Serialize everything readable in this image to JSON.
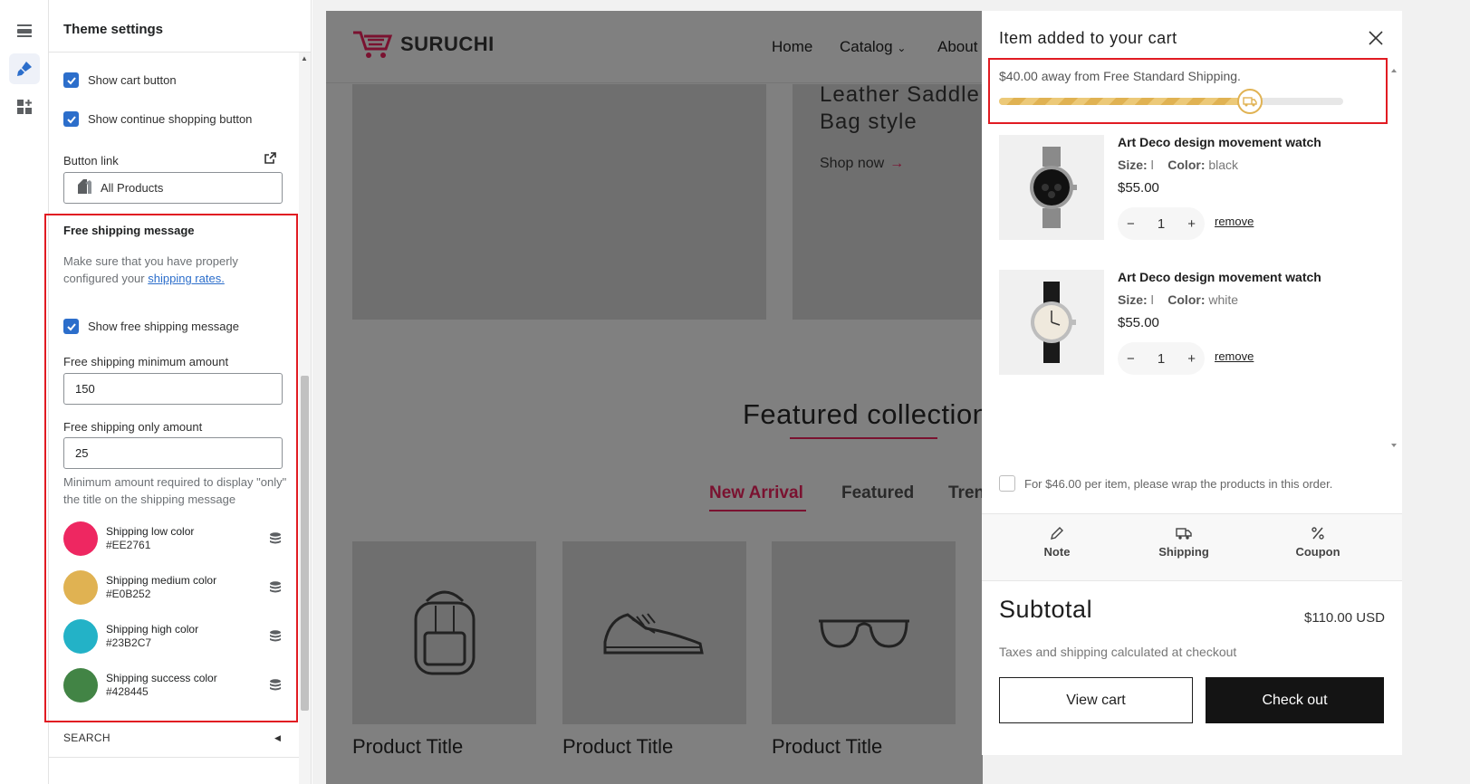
{
  "sidebar": {
    "title": "Theme settings",
    "show_cart_button": "Show cart button",
    "show_continue_button": "Show continue shopping button",
    "button_link_label": "Button link",
    "button_link_value": "All Products",
    "free_shipping": {
      "heading": "Free shipping message",
      "help_prefix": "Make sure that you have properly configured your",
      "help_link": "shipping rates.",
      "show_message_label": "Show free shipping message",
      "min_amount_label": "Free shipping minimum amount",
      "min_amount_value": "150",
      "only_amount_label": "Free shipping only amount",
      "only_amount_value": "25",
      "only_amount_help": "Minimum amount required to display \"only\" the title on the shipping message",
      "colors": [
        {
          "label": "Shipping low color",
          "hex": "#EE2761"
        },
        {
          "label": "Shipping medium color",
          "hex": "#E0B252"
        },
        {
          "label": "Shipping high color",
          "hex": "#23B2C7"
        },
        {
          "label": "Shipping success color",
          "hex": "#428445"
        }
      ]
    },
    "search_section": "SEARCH"
  },
  "store": {
    "logo": "SURUCHI",
    "nav": [
      "Home",
      "Catalog",
      "About"
    ],
    "hero_text_line1": "Leather Saddle",
    "hero_text_line2": "Bag style",
    "shop_now": "Shop now",
    "featured_title": "Featured collection",
    "tabs": [
      "New Arrival",
      "Featured",
      "Tren"
    ],
    "product_titles": [
      "Product Title",
      "Product Title",
      "Product Title"
    ]
  },
  "cart": {
    "title": "Item added to your cart",
    "shipping_message": "$40.00 away from Free Standard Shipping.",
    "progress": 0.73,
    "items": [
      {
        "name": "Art Deco design movement watch",
        "size_label": "Size:",
        "size_value": "l",
        "color_label": "Color:",
        "color_value": "black",
        "price": "$55.00",
        "qty": "1",
        "remove": "remove"
      },
      {
        "name": "Art Deco design movement watch",
        "size_label": "Size:",
        "size_value": "l",
        "color_label": "Color:",
        "color_value": "white",
        "price": "$55.00",
        "qty": "1",
        "remove": "remove"
      }
    ],
    "gift_wrap": "For $46.00 per item, please wrap the products in this order.",
    "tools": [
      "Note",
      "Shipping",
      "Coupon"
    ],
    "subtotal_label": "Subtotal",
    "subtotal_value": "$110.00 USD",
    "tax_note": "Taxes and shipping calculated at checkout",
    "view_cart": "View cart",
    "check_out": "Check out"
  },
  "colors": {
    "accent_blue": "#2c6ecb",
    "brand_maroon": "#7a1230",
    "highlight_red": "#e11b22"
  }
}
